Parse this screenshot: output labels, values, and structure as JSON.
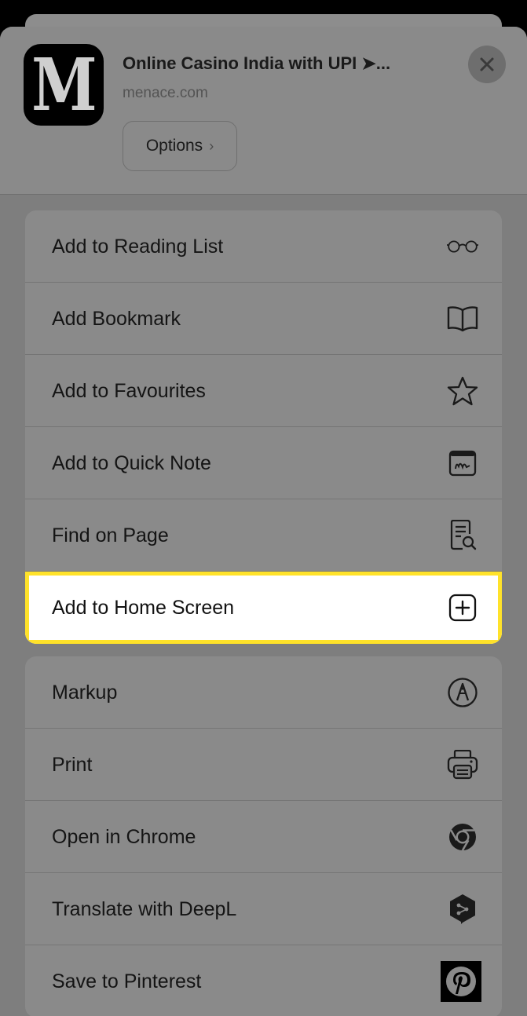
{
  "header": {
    "app_icon_letter": "M",
    "title": "Online Casino India with UPI ➤...",
    "subtitle": "menace.com",
    "options_label": "Options",
    "options_chevron": "›",
    "close_icon": "close-icon"
  },
  "group1": [
    {
      "label": "Add to Reading List",
      "icon": "glasses-icon"
    },
    {
      "label": "Add Bookmark",
      "icon": "book-icon"
    },
    {
      "label": "Add to Favourites",
      "icon": "star-icon"
    },
    {
      "label": "Add to Quick Note",
      "icon": "quick-note-icon"
    },
    {
      "label": "Find on Page",
      "icon": "find-on-page-icon"
    },
    {
      "label": "Add to Home Screen",
      "icon": "add-square-icon",
      "highlighted": true
    }
  ],
  "group2": [
    {
      "label": "Markup",
      "icon": "markup-icon"
    },
    {
      "label": "Print",
      "icon": "print-icon"
    },
    {
      "label": "Open in Chrome",
      "icon": "chrome-icon"
    },
    {
      "label": "Translate with DeepL",
      "icon": "deepl-icon"
    },
    {
      "label": "Save to Pinterest",
      "icon": "pinterest-icon"
    }
  ],
  "colors": {
    "highlight_border": "#ffe22a",
    "sheet": "#7e7e7e",
    "row_bg": "#8a8a8a"
  }
}
